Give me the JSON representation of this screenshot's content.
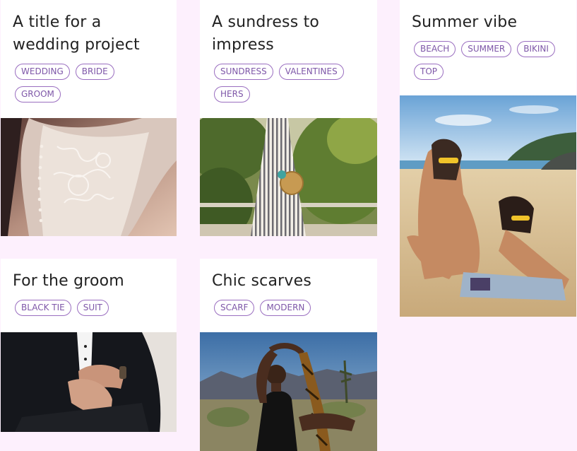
{
  "cards": [
    {
      "title": "A title for a wedding project",
      "tags": [
        "WEDDING",
        "BRIDE",
        "GROOM"
      ],
      "photo": "wedding-dress-lace-back-photo"
    },
    {
      "title": "A sundress to impress",
      "tags": [
        "SUNDRESS",
        "VALENTINES",
        "HERS"
      ],
      "photo": "striped-sundress-photo"
    },
    {
      "title": "Summer vibe",
      "tags": [
        "BEACH",
        "SUMMER",
        "BIKINI",
        "TOP"
      ],
      "photo": "beach-women-sunglasses-photo"
    },
    {
      "title": "For the groom",
      "tags": [
        "BLACK TIE",
        "SUIT"
      ],
      "photo": "groom-suit-cufflinks-photo"
    },
    {
      "title": "Chic scarves",
      "tags": [
        "SCARF",
        "MODERN"
      ],
      "photo": "desert-woman-scarf-photo"
    }
  ]
}
